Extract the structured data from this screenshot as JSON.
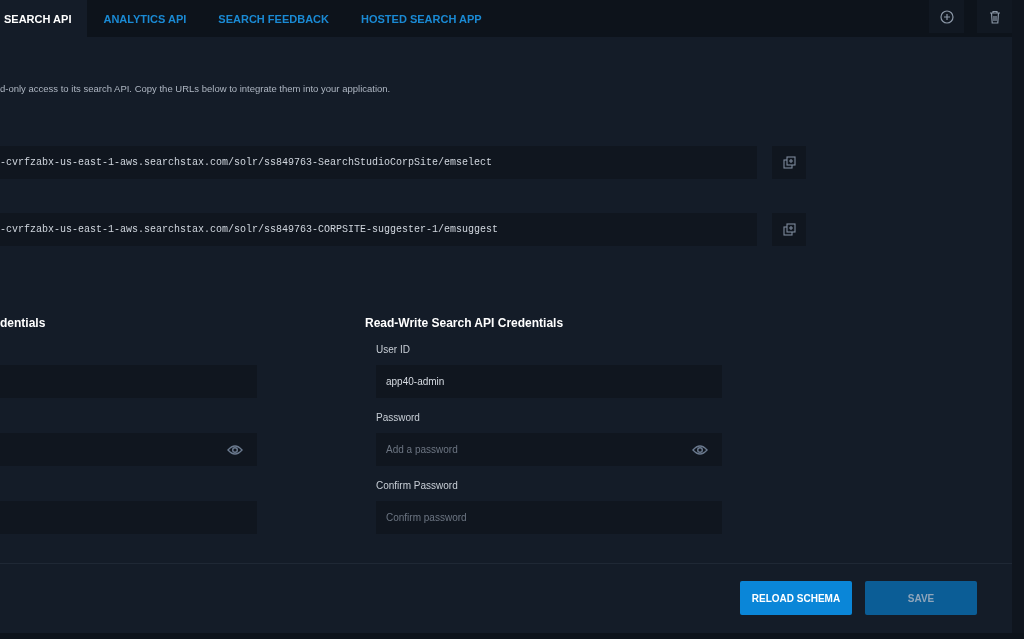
{
  "tabs": [
    {
      "label": "SEARCH API",
      "selected": true
    },
    {
      "label": "ANALYTICS API",
      "selected": false
    },
    {
      "label": "SEARCH FEEDBACK",
      "selected": false
    },
    {
      "label": "HOSTED SEARCH APP",
      "selected": false
    }
  ],
  "top_actions": [
    {
      "kind": "add"
    },
    {
      "kind": "delete"
    }
  ],
  "description": "d-only access to its search API. Copy the URLs below to integrate them into your application.",
  "urls": [
    {
      "value": "-cvrfzabx-us-east-1-aws.searchstax.com/solr/ss849763-SearchStudioCorpSite/emselect"
    },
    {
      "value": "-cvrfzabx-us-east-1-aws.searchstax.com/solr/ss849763-CORPSITE-suggester-1/emsuggest"
    }
  ],
  "credentials": [
    {
      "title": "dentials",
      "fields": [
        {
          "kind": "text"
        },
        {
          "kind": "password"
        },
        {
          "kind": "text"
        }
      ]
    },
    {
      "title": "Read-Write Search API Credentials",
      "fields": [
        {
          "kind": "text",
          "label": "User ID",
          "value": "app40-admin"
        },
        {
          "kind": "password",
          "label": "Password",
          "placeholder": "Add a password"
        },
        {
          "kind": "text",
          "label": "Confirm Password",
          "placeholder": "Confirm password"
        }
      ]
    }
  ],
  "buttons": [
    {
      "label": "RELOAD SCHEMA",
      "disabled": false
    },
    {
      "label": "SAVE",
      "disabled": true
    }
  ]
}
